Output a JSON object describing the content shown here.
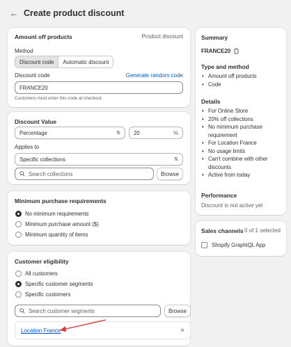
{
  "header": {
    "title": "Create product discount"
  },
  "amount_off": {
    "title": "Amount off products",
    "subtitle": "Product discount",
    "method_label": "Method",
    "method_options": [
      "Discount code",
      "Automatic discount"
    ],
    "code_label": "Discount code",
    "generate_link": "Generate random code",
    "code_value": "FRANCE20",
    "help_text": "Customers must enter this code at checkout."
  },
  "discount_value": {
    "title": "Discount Value",
    "type_value": "Percentage",
    "amount_value": "20",
    "amount_suffix": "%",
    "applies_to_label": "Applies to",
    "applies_to_value": "Specific collections",
    "search_placeholder": "Search collections",
    "browse_label": "Browse"
  },
  "min_req": {
    "title": "Minimum purchase requirements",
    "options": [
      "No minimum requirements",
      "Minimum purchase amount ($)",
      "Minimum quantity of items"
    ]
  },
  "eligibility": {
    "title": "Customer eligibility",
    "options": [
      "All customers",
      "Specific customer segments",
      "Specific customers"
    ],
    "search_placeholder": "Search customer segments",
    "browse_label": "Browse",
    "selected_segment": "Location France",
    "remove_icon": "×"
  },
  "summary": {
    "title": "Summary",
    "code": "FRANCE20",
    "type_title": "Type and method",
    "type_items": [
      "Amount off products",
      "Code"
    ],
    "details_title": "Details",
    "details_items": [
      "For Online Store",
      "20% off collections",
      "No minimum purchase requirement",
      "For Location France",
      "No usage limits",
      "Can't combine with other discounts",
      "Active from today"
    ],
    "performance_title": "Performance",
    "performance_text": "Discount is not active yet"
  },
  "sales_channels": {
    "title": "Sales channels",
    "count": "0 of 1 selected",
    "items": [
      "Shopify GraphiQL App"
    ]
  },
  "colors": {
    "link": "#005bd3",
    "annotation_arrow": "#e0302f",
    "background": "#f1f1f1"
  }
}
